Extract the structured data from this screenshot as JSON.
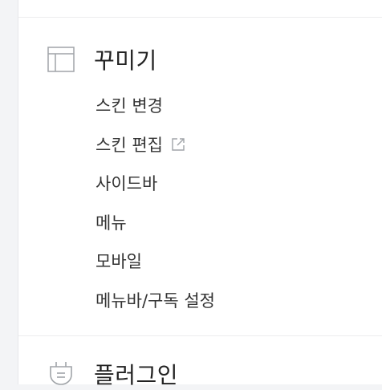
{
  "sections": [
    {
      "title": "꾸미기",
      "icon": "layout-icon",
      "items": [
        {
          "label": "스킨 변경",
          "external": false
        },
        {
          "label": "스킨 편집",
          "external": true
        },
        {
          "label": "사이드바",
          "external": false
        },
        {
          "label": "메뉴",
          "external": false
        },
        {
          "label": "모바일",
          "external": false
        },
        {
          "label": "메뉴바/구독 설정",
          "external": false
        }
      ]
    },
    {
      "title": "플러그인",
      "icon": "plug-icon",
      "items": []
    }
  ],
  "colors": {
    "background": "#f3f4f6",
    "panel": "#ffffff",
    "text": "#333333",
    "title": "#222222",
    "icon": "#a0a4a8",
    "divider": "#ececee"
  }
}
